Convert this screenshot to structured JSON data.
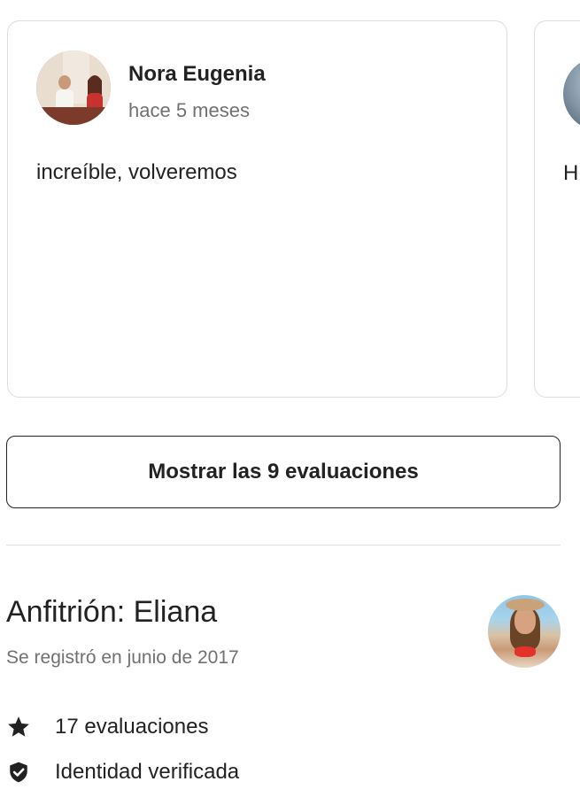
{
  "reviews": [
    {
      "name": "Nora Eugenia",
      "date": "hace 5 meses",
      "text": "increíble, volveremos"
    },
    {
      "name": "",
      "date": "",
      "text": "H g"
    }
  ],
  "show_all_button": {
    "label": "Mostrar las 9 evaluaciones"
  },
  "host": {
    "title": "Anfitrión: Eliana",
    "joined": "Se registró en junio de 2017",
    "stats": [
      {
        "icon": "star-icon",
        "label": "17 evaluaciones"
      },
      {
        "icon": "verified-shield-icon",
        "label": "Identidad verificada"
      }
    ]
  },
  "colors": {
    "text_primary": "#222222",
    "text_secondary": "#717171",
    "border": "#dddddd"
  }
}
